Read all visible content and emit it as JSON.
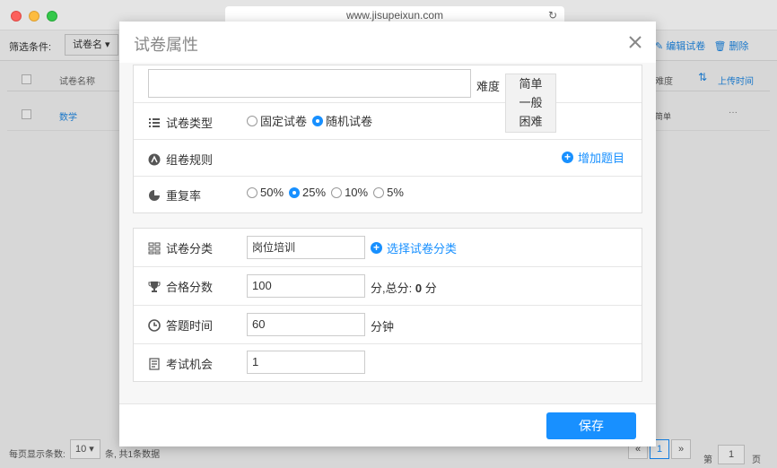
{
  "browser": {
    "url": "www.jisupeixun.com"
  },
  "bg": {
    "filter_label": "筛选条件:",
    "filter_value": "试卷名",
    "tool_edit": "编辑试卷",
    "tool_delete": "删除",
    "col_name": "试卷名称",
    "col_difficulty": "难度",
    "col_upload_time": "上传时间",
    "row_name": "数学",
    "row_difficulty": "简单",
    "row_more": "···",
    "per_page_label": "每页显示条数:",
    "per_page_value": "10",
    "per_page_after": "条, 共1条数据",
    "prev": "«",
    "current_page": "1",
    "next": "»",
    "page_label": "第",
    "page_input": "1",
    "page_unit": "页"
  },
  "modal": {
    "title": "试卷属性",
    "difficulty": {
      "label": "难度",
      "options": [
        "简单",
        "一般",
        "困难"
      ]
    },
    "type": {
      "label": "试卷类型",
      "options": [
        "固定试卷",
        "随机试卷"
      ],
      "selected": "随机试卷"
    },
    "rule": {
      "label": "组卷规则",
      "add_label": "增加题目"
    },
    "repeat": {
      "label": "重复率",
      "options": [
        "50%",
        "25%",
        "10%",
        "5%"
      ],
      "selected": "25%"
    },
    "category": {
      "label": "试卷分类",
      "value": "岗位培训",
      "select_label": "选择试卷分类"
    },
    "pass_score": {
      "label": "合格分数",
      "value": "100",
      "suffix": "分,总分:",
      "total": "0",
      "unit": "分"
    },
    "time": {
      "label": "答题时间",
      "value": "60",
      "unit": "分钟"
    },
    "chances": {
      "label": "考试机会",
      "value": "1"
    },
    "save_label": "保存"
  },
  "colors": {
    "accent": "#1890ff"
  },
  "icons": {
    "type": "list-icon",
    "rule": "rule-icon",
    "repeat": "pie-icon",
    "category": "category-icon",
    "pass_score": "trophy-icon",
    "time": "clock-icon",
    "chances": "doc-icon",
    "close": "close-icon"
  }
}
